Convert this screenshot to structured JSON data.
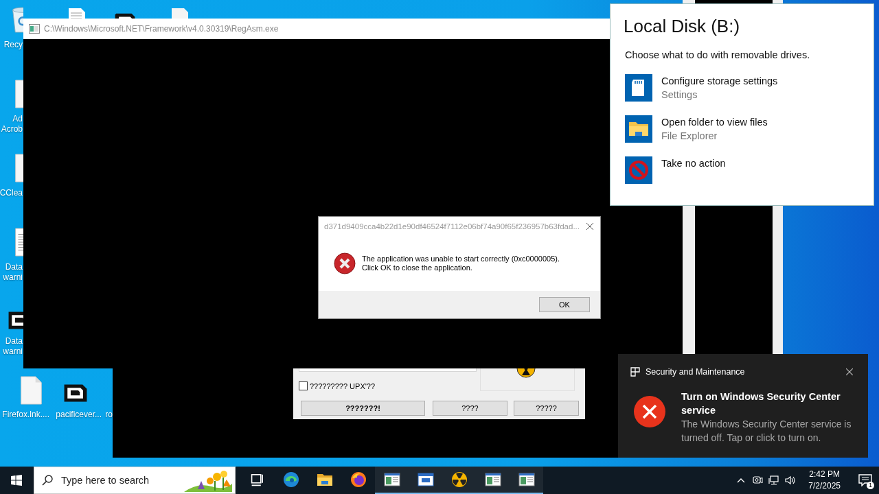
{
  "desktop_icons": [
    {
      "kind": "recycle-bin",
      "lines": [
        "Recy"
      ]
    },
    {
      "kind": "blank-file",
      "lines": [
        "Ad",
        "Acrob"
      ]
    },
    {
      "kind": "blank-file",
      "lines": [
        "CClea"
      ]
    },
    {
      "kind": "text-file",
      "lines": [
        "Data",
        "warni"
      ]
    },
    {
      "kind": "logo",
      "lines": [
        "Data",
        "warni"
      ]
    },
    {
      "kind": "blank-file",
      "lines": [
        "Firefox.lnk...."
      ]
    },
    {
      "kind": "logo",
      "lines": [
        "pacificever..."
      ]
    },
    {
      "kind": "none",
      "lines": [
        "ro"
      ]
    }
  ],
  "console_window": {
    "title": "C:\\Windows\\Microsoft.NET\\Framework\\v4.0.30319\\RegAsm.exe"
  },
  "packer_window": {
    "checkbox": {
      "label": "????????? UPX'??",
      "checked": false
    },
    "buttons": [
      {
        "label": "???????!",
        "default": true
      },
      {
        "label": "????",
        "default": false
      },
      {
        "label": "?????",
        "default": false
      }
    ]
  },
  "error_dialog": {
    "title": "d371d9409cca4b22d1e90df46524f7112e06bf74a90f65f236957b63fdad...",
    "message": [
      "The application was unable to start correctly (0xc0000005).",
      "Click OK to close the application."
    ],
    "button": "OK"
  },
  "autoplay": {
    "title": "Local Disk (B:)",
    "prompt": "Choose what to do with removable drives.",
    "options": [
      {
        "kind": "storage",
        "title": "Configure storage settings",
        "subtitle": "Settings"
      },
      {
        "kind": "folder",
        "title": "Open folder to view files",
        "subtitle": "File Explorer"
      },
      {
        "kind": "none",
        "title": "Take no action"
      }
    ]
  },
  "toast": {
    "app": "Security and Maintenance",
    "title": "Turn on Windows Security Center service",
    "body": "The Windows Security Center service is turned off. Tap or click to turn on."
  },
  "taskbar": {
    "search_placeholder": "Type here to search",
    "apps": [
      {
        "kind": "task-view",
        "running": false
      },
      {
        "kind": "edge",
        "running": false
      },
      {
        "kind": "folder",
        "running": false
      },
      {
        "kind": "firefox",
        "running": false
      },
      {
        "kind": "window",
        "running": true
      },
      {
        "kind": "blue-window",
        "running": true
      },
      {
        "kind": "radiation",
        "running": true
      },
      {
        "kind": "window",
        "running": true
      },
      {
        "kind": "window",
        "running": true
      }
    ],
    "time": "2:42 PM",
    "date": "7/2/2025",
    "notification_count": "1"
  }
}
